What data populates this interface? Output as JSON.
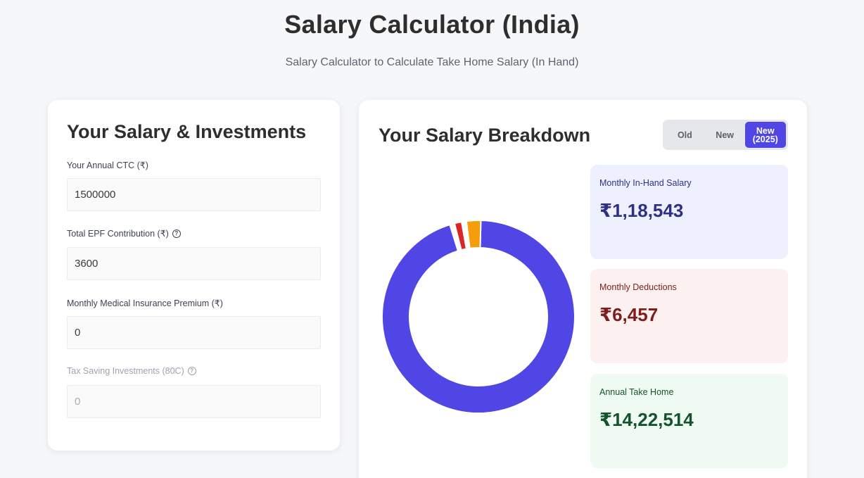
{
  "page": {
    "title": "Salary Calculator (India)",
    "subtitle": "Salary Calculator to Calculate Take Home Salary (In Hand)"
  },
  "inputs_card": {
    "title": "Your Salary & Investments",
    "fields": [
      {
        "label": "Your Annual CTC (₹)",
        "value": "1500000",
        "has_help": false,
        "disabled": false
      },
      {
        "label": "Total EPF Contribution (₹)",
        "value": "3600",
        "has_help": true,
        "disabled": false
      },
      {
        "label": "Monthly Medical Insurance Premium (₹)",
        "value": "0",
        "has_help": false,
        "disabled": false
      },
      {
        "label": "Tax Saving Investments (80C)",
        "value": "0",
        "has_help": true,
        "disabled": true
      }
    ]
  },
  "breakdown_card": {
    "title": "Your Salary Breakdown",
    "regime_options": [
      {
        "label": "Old",
        "active": false
      },
      {
        "label": "New",
        "active": false
      },
      {
        "label_line1": "New",
        "label_line2": "(2025)",
        "active": true
      }
    ],
    "stats": {
      "inhand": {
        "label": "Monthly In-Hand Salary",
        "value": "₹1,18,543"
      },
      "deductions": {
        "label": "Monthly Deductions",
        "value": "₹6,457"
      },
      "annual": {
        "label": "Annual Take Home",
        "value": "₹14,22,514"
      }
    }
  },
  "chart_data": {
    "type": "pie",
    "style": "donut",
    "categories": [
      "segment-1",
      "segment-2",
      "segment-3"
    ],
    "values": [
      94.8,
      1.2,
      2.4
    ],
    "colors": [
      "#4f46e5",
      "#dc2626",
      "#f59e0b"
    ]
  },
  "colors": {
    "accent": "#4f46e5",
    "inhand_bg": "#eef1fd",
    "deductions_bg": "#fdf0f0",
    "annual_bg": "#effaf2"
  }
}
